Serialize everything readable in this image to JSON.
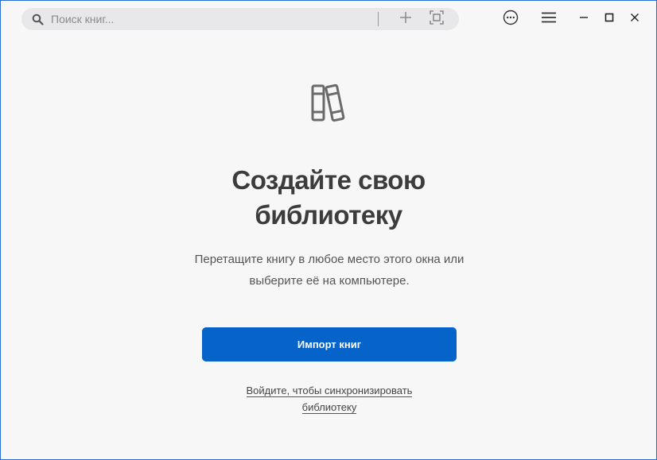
{
  "toolbar": {
    "search_placeholder": "Поиск книг...",
    "icons": [
      "search-icon",
      "add-icon",
      "focus-frame-icon",
      "more-icon",
      "menu-icon",
      "minimize-icon",
      "maximize-icon",
      "close-icon"
    ]
  },
  "empty_state": {
    "icon": "library-books-icon",
    "title_line1": "Создайте свою",
    "title_line2": "библиотеку",
    "subtitle_line1": "Перетащите книгу в любое место этого окна или",
    "subtitle_line2": "выберите её на компьютере.",
    "import_button": "Импорт книг",
    "signin_line1": "Войдите, чтобы синхронизировать",
    "signin_line2": "библиотеку"
  },
  "colors": {
    "accent": "#0563c9",
    "background": "#f7f7f8",
    "search_bg": "#e8e8ea",
    "window_border": "#2a6fd6"
  }
}
